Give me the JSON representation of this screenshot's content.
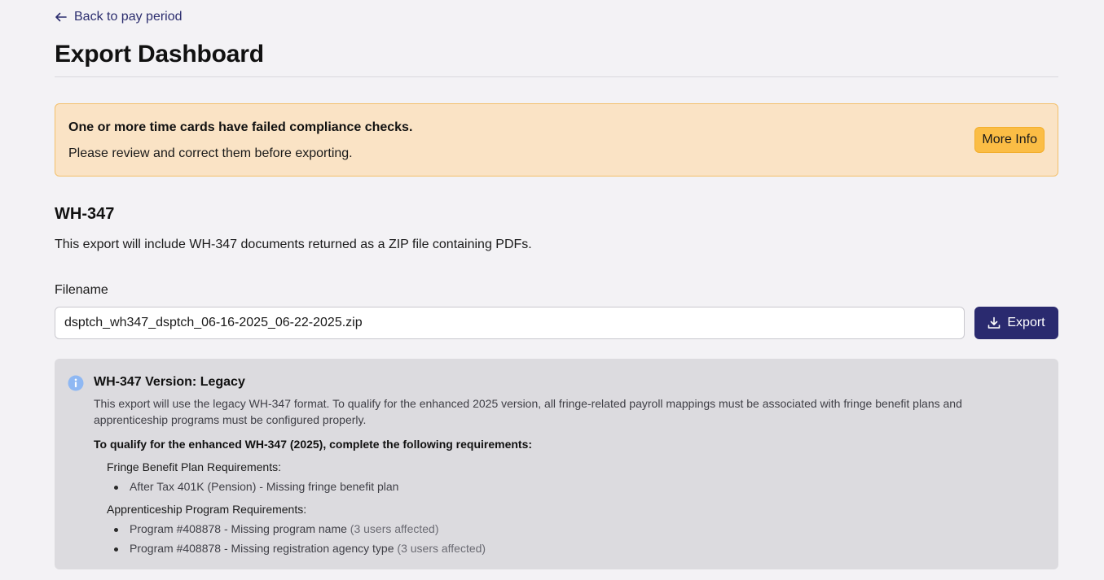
{
  "nav": {
    "back_label": "Back to pay period"
  },
  "header": {
    "title": "Export Dashboard"
  },
  "alert": {
    "title": "One or more time cards have failed compliance checks.",
    "text": "Please review and correct them before exporting.",
    "button_label": "More Info",
    "colors": {
      "background": "#fae3c5",
      "border": "#f3c06b",
      "button": "#fbbd45"
    }
  },
  "export_section": {
    "title": "WH-347",
    "description": "This export will include WH-347 documents returned as a ZIP file containing PDFs.",
    "filename_label": "Filename",
    "filename_value": "dsptch_wh347_dsptch_06-16-2025_06-22-2025.zip",
    "export_button_label": "Export",
    "export_button_icon": "download-icon",
    "accent_color": "#2a2a6f"
  },
  "version_info": {
    "icon": "info-icon",
    "title": "WH-347 Version: Legacy",
    "text": "This export will use the legacy WH-347 format. To qualify for the enhanced 2025 version, all fringe-related payroll mappings must be associated with fringe benefit plans and apprenticeship programs must be configured properly.",
    "requirements_heading": "To qualify for the enhanced WH-347 (2025), complete the following requirements:",
    "groups": [
      {
        "heading": "Fringe Benefit Plan Requirements:",
        "items": [
          {
            "text": "After Tax 401K (Pension) - Missing fringe benefit plan",
            "note": ""
          }
        ]
      },
      {
        "heading": "Apprenticeship Program Requirements:",
        "items": [
          {
            "text": "Program #408878 - Missing program name",
            "note": "(3 users affected)"
          },
          {
            "text": "Program #408878 - Missing registration agency type",
            "note": "(3 users affected)"
          }
        ]
      }
    ]
  }
}
